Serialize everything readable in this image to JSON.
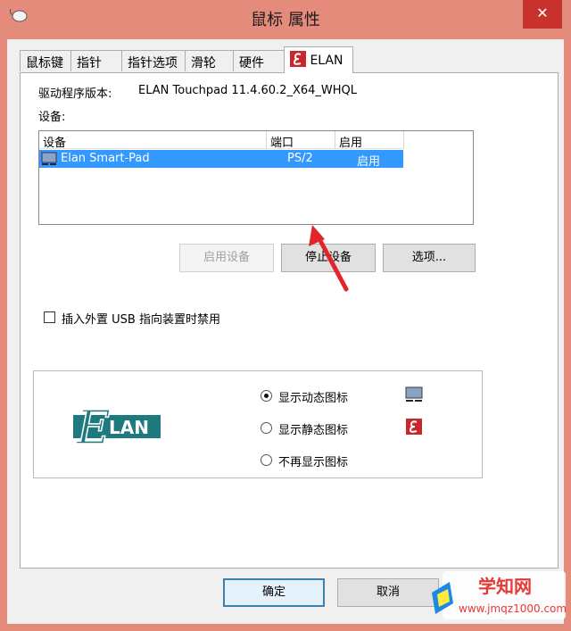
{
  "window": {
    "title": "鼠标 属性",
    "close_glyph": "✕"
  },
  "tabs": [
    "鼠标键",
    "指针",
    "指针选项",
    "滑轮",
    "硬件",
    "ELAN"
  ],
  "driver": {
    "label": "驱动程序版本:",
    "value": "ELAN Touchpad 11.4.60.2_X64_WHQL"
  },
  "devices_label": "设备:",
  "device_list": {
    "columns": [
      "设备",
      "端口",
      "启用"
    ],
    "rows": [
      {
        "name": "Elan Smart-Pad",
        "port": "PS/2",
        "enabled": "启用"
      }
    ]
  },
  "buttons": {
    "enable": "启用设备",
    "stop": "停止设备",
    "options": "选项..."
  },
  "usb_checkbox": {
    "label": "插入外置 USB 指向装置时禁用",
    "checked": false
  },
  "logo": {
    "text": "LAN",
    "initial": "E"
  },
  "tray_icon_options": [
    {
      "label": "显示动态图标",
      "selected": true,
      "icon": "monitor-icon"
    },
    {
      "label": "显示静态图标",
      "selected": false,
      "icon": "elan-icon"
    },
    {
      "label": "不再显示图标",
      "selected": false,
      "icon": ""
    }
  ],
  "footer": {
    "ok": "确定",
    "cancel": "取消"
  },
  "watermark": {
    "title": "学知网",
    "url": "www.jmqz1000.com"
  },
  "colors": {
    "frame": "#e58b7b",
    "selection": "#3399ff",
    "elan_teal": "#1f7a80",
    "elan_red": "#c8272b",
    "arrow": "#e0262b"
  }
}
